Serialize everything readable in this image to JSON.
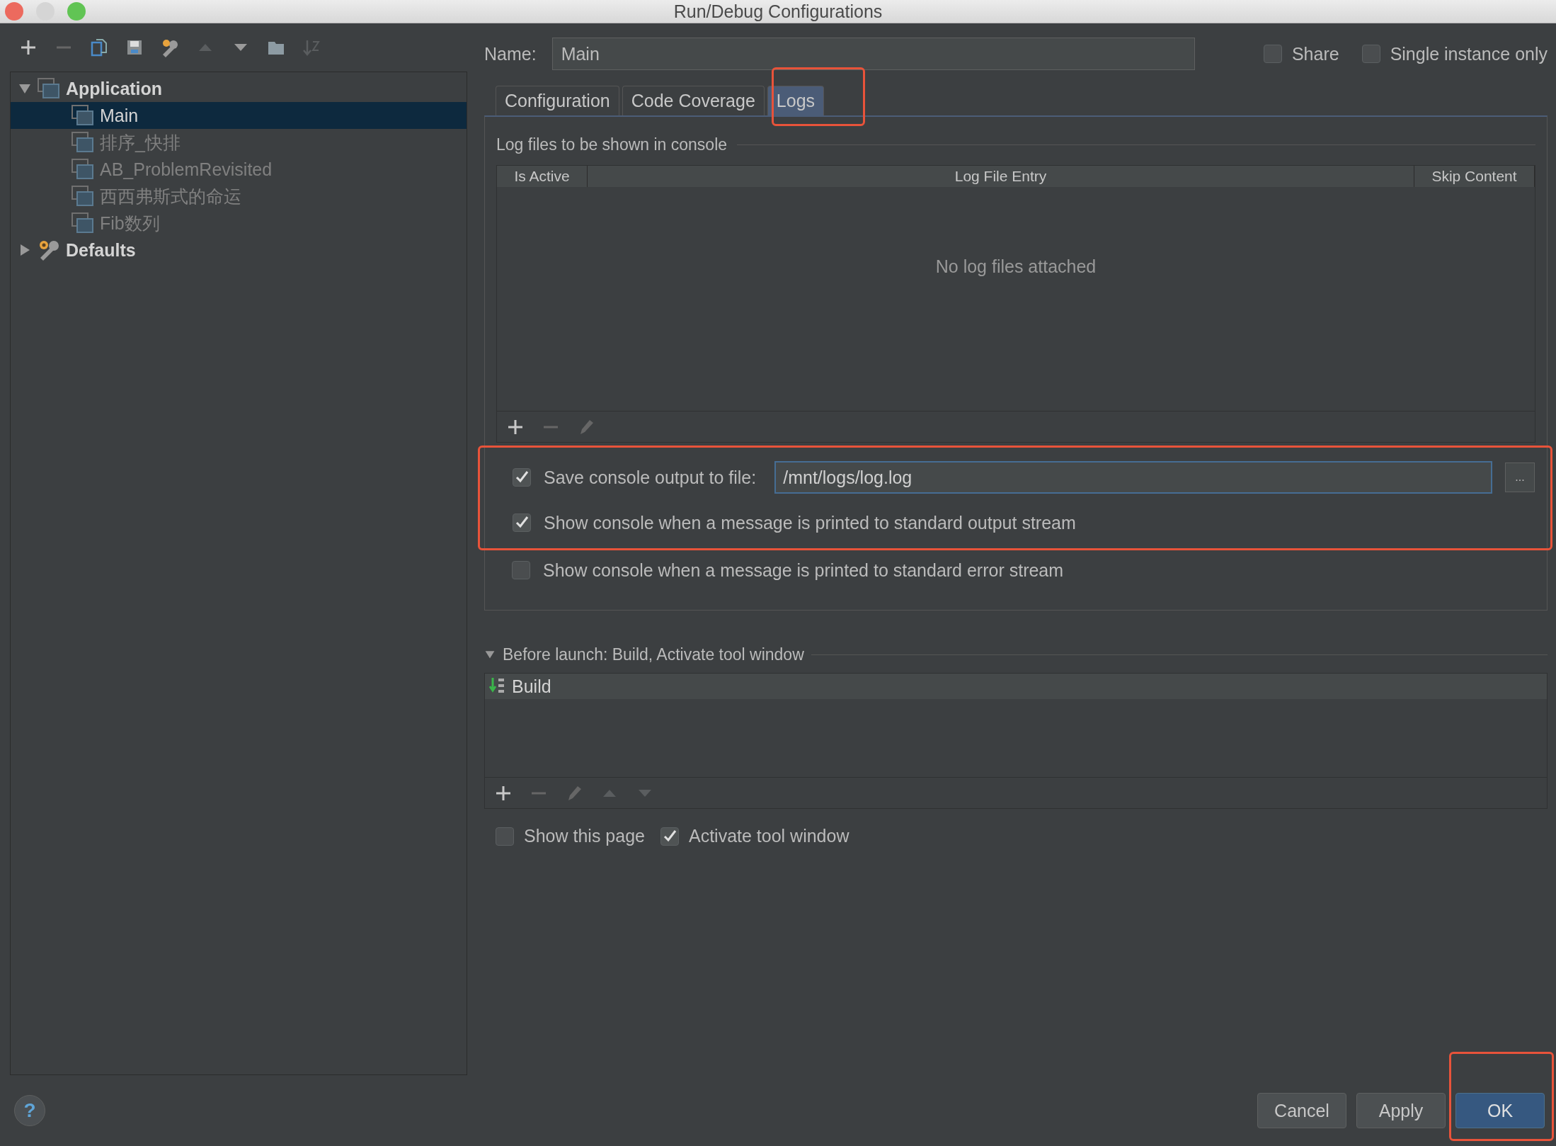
{
  "window": {
    "title": "Run/Debug Configurations"
  },
  "tree": [
    {
      "label": "Application",
      "selected": false,
      "expanded": true,
      "children": [
        {
          "label": "Main",
          "selected": true
        },
        {
          "label": "排序_快排",
          "selected": false
        },
        {
          "label": "AB_ProblemRevisited",
          "selected": false
        },
        {
          "label": "西西弗斯式的命运",
          "selected": false
        },
        {
          "label": "Fib数列",
          "selected": false
        }
      ]
    },
    {
      "label": "Defaults",
      "selected": false,
      "expanded": false
    }
  ],
  "name_field": {
    "label": "Name:",
    "value": "Main"
  },
  "options": [
    {
      "label": "Share",
      "checked": false
    },
    {
      "label": "Single instance only",
      "checked": false
    }
  ],
  "tabs": [
    {
      "label": "Configuration",
      "selected": false
    },
    {
      "label": "Code Coverage",
      "selected": false
    },
    {
      "label": "Logs",
      "selected": true
    }
  ],
  "logs": {
    "section_title": "Log files to be shown in console",
    "columns": [
      "Is Active",
      "Log File Entry",
      "Skip Content"
    ],
    "empty_text": "No log files attached",
    "save_output": {
      "label": "Save console output to file:",
      "checked": true,
      "value": "/mnt/logs/log.log",
      "browse_label": "..."
    },
    "stream_options": [
      {
        "label": "Show console when a message is printed to standard output stream",
        "checked": true
      },
      {
        "label": "Show console when a message is printed to standard error stream",
        "checked": false
      }
    ]
  },
  "before_launch": {
    "title": "Before launch: Build, Activate tool window",
    "expanded": true,
    "tasks": [
      {
        "label": "Build"
      }
    ],
    "options": [
      {
        "label": "Show this page",
        "checked": false
      },
      {
        "label": "Activate tool window",
        "checked": true
      }
    ]
  },
  "help": "?",
  "buttons": [
    {
      "label": "Cancel",
      "primary": false
    },
    {
      "label": "Apply",
      "primary": false
    },
    {
      "label": "OK",
      "primary": true
    }
  ]
}
